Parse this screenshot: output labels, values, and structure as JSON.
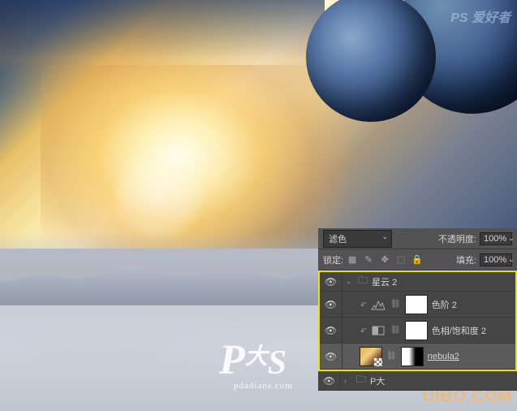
{
  "watermarks": {
    "ps_p": "P",
    "ps_s": "S",
    "ps_d": "大",
    "ps_url": "pdadians.com",
    "corner": "PS 爱好者",
    "bottom": "UIBO.COM"
  },
  "panel": {
    "blend_mode": "滤色",
    "opacity_label": "不透明度:",
    "opacity_value": "100%",
    "lock_label": "锁定:",
    "fill_label": "填充:",
    "fill_value": "100%"
  },
  "layers": {
    "group1": {
      "name": "星云 2"
    },
    "levels": {
      "name": "色阶 2"
    },
    "huesat": {
      "name": "色相/饱和度 2"
    },
    "nebula": {
      "name": "nebula2"
    },
    "group2": {
      "name": "P大"
    }
  }
}
